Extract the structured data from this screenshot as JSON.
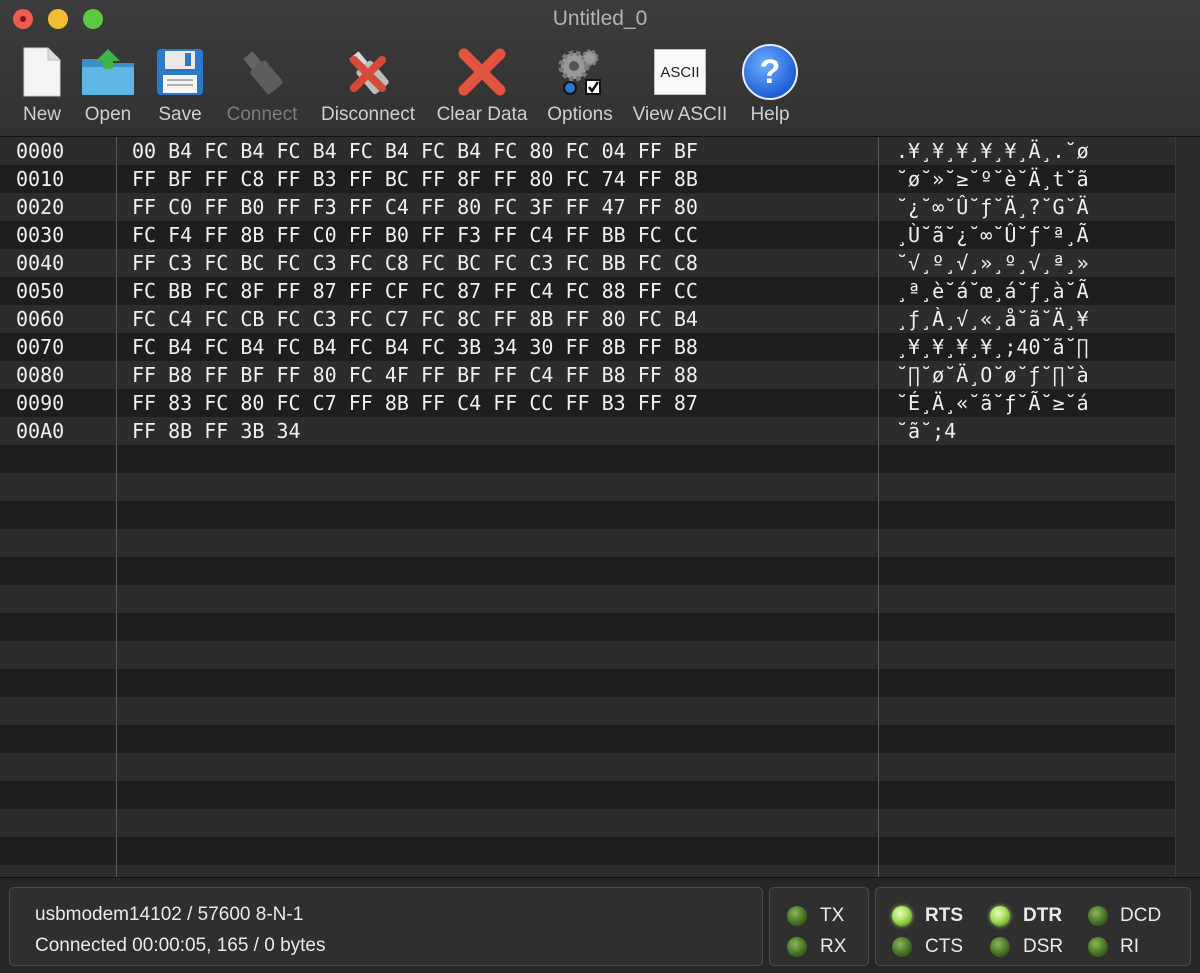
{
  "window": {
    "title": "Untitled_0"
  },
  "toolbar": {
    "new_label": "New",
    "open_label": "Open",
    "save_label": "Save",
    "connect_label": "Connect",
    "disconnect_label": "Disconnect",
    "clear_label": "Clear Data",
    "options_label": "Options",
    "view_ascii_label": "View ASCII",
    "view_ascii_icon_text": "ASCII",
    "help_label": "Help",
    "help_icon_text": "?"
  },
  "hex": {
    "rows": [
      {
        "addr": "0000",
        "hex": "00 B4 FC B4 FC B4 FC B4 FC B4 FC 80 FC 04 FF BF",
        "ascii": ".¥¸¥¸¥¸¥¸¥¸Ä¸.˘ø"
      },
      {
        "addr": "0010",
        "hex": "FF BF FF C8 FF B3 FF BC FF 8F FF 80 FC 74 FF 8B",
        "ascii": "˘ø˘»˘≥˘º˘è˘Ä¸t˘ã"
      },
      {
        "addr": "0020",
        "hex": "FF C0 FF B0 FF F3 FF C4 FF 80 FC 3F FF 47 FF 80",
        "ascii": "˘¿˘∞˘Û˘ƒ˘Ä¸?˘G˘Ä"
      },
      {
        "addr": "0030",
        "hex": "FC F4 FF 8B FF C0 FF B0 FF F3 FF C4 FF BB FC CC",
        "ascii": "¸Ù˘ã˘¿˘∞˘Û˘ƒ˘ª¸Ã"
      },
      {
        "addr": "0040",
        "hex": "FF C3 FC BC FC C3 FC C8 FC BC FC C3 FC BB FC C8",
        "ascii": "˘√¸º¸√¸»¸º¸√¸ª¸»"
      },
      {
        "addr": "0050",
        "hex": "FC BB FC 8F FF 87 FF CF FC 87 FF C4 FC 88 FF CC",
        "ascii": "¸ª¸è˘á˘œ¸á˘ƒ¸à˘Ã"
      },
      {
        "addr": "0060",
        "hex": "FC C4 FC CB FC C3 FC C7 FC 8C FF 8B FF 80 FC B4",
        "ascii": "¸ƒ¸À¸√¸«¸å˘ã˘Ä¸¥"
      },
      {
        "addr": "0070",
        "hex": "FC B4 FC B4 FC B4 FC B4 FC 3B 34 30 FF 8B FF B8",
        "ascii": "¸¥¸¥¸¥¸¥¸;40˘ã˘∏"
      },
      {
        "addr": "0080",
        "hex": "FF B8 FF BF FF 80 FC 4F FF BF FF C4 FF B8 FF 88",
        "ascii": "˘∏˘ø˘Ä¸O˘ø˘ƒ˘∏˘à"
      },
      {
        "addr": "0090",
        "hex": "FF 83 FC 80 FC C7 FF 8B FF C4 FF CC FF B3 FF 87",
        "ascii": "˘É¸Ä¸«˘ã˘ƒ˘Ã˘≥˘á"
      },
      {
        "addr": "00A0",
        "hex": "FF 8B FF 3B 34",
        "ascii": "˘ã˘;4"
      }
    ]
  },
  "status": {
    "port_info": "usbmodem14102 / 57600 8-N-1",
    "connection_info": "Connected 00:00:05, 165 / 0 bytes"
  },
  "leds": {
    "tx": {
      "label": "TX",
      "on": false
    },
    "rx": {
      "label": "RX",
      "on": false
    },
    "rts": {
      "label": "RTS",
      "on": true
    },
    "dtr": {
      "label": "DTR",
      "on": true
    },
    "dcd": {
      "label": "DCD",
      "on": false
    },
    "cts": {
      "label": "CTS",
      "on": false
    },
    "dsr": {
      "label": "DSR",
      "on": false
    },
    "ri": {
      "label": "RI",
      "on": false
    }
  }
}
